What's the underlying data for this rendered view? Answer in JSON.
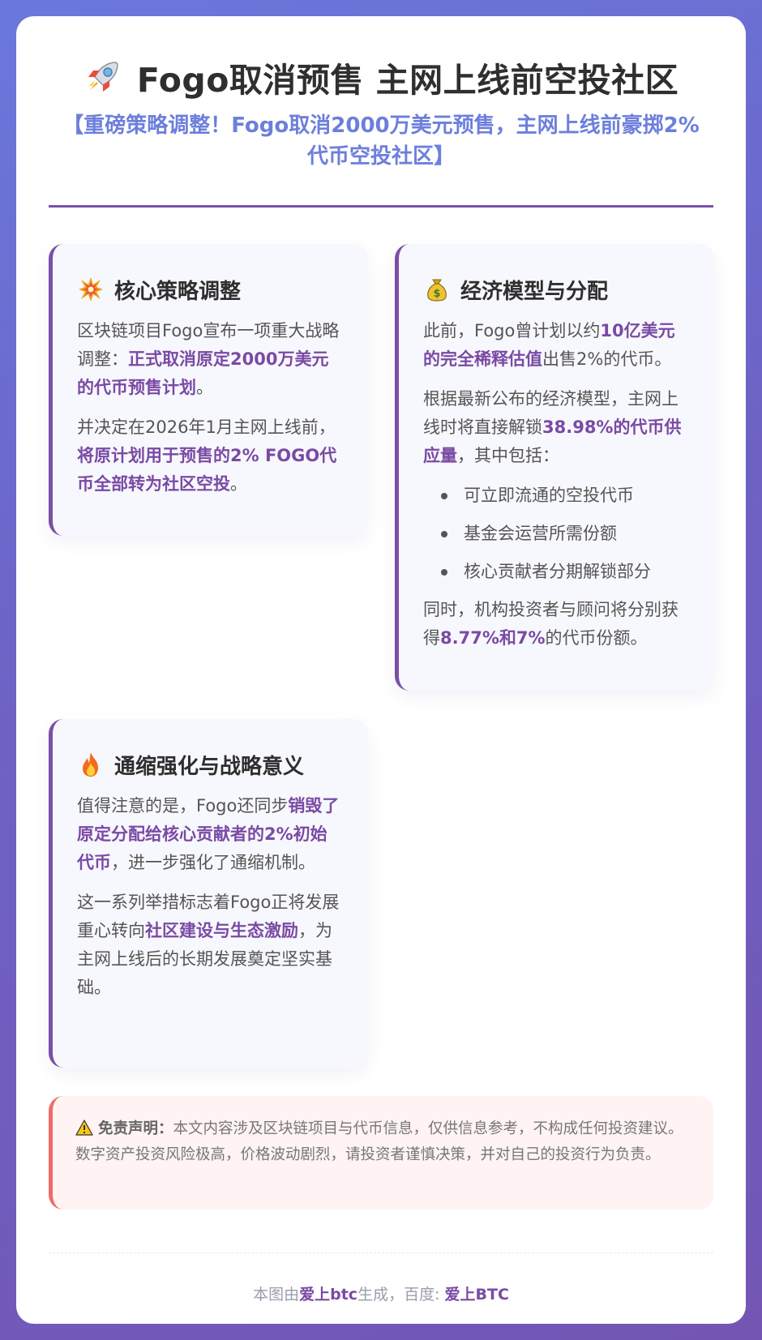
{
  "header": {
    "title": "Fogo取消预售 主网上线前空投社区",
    "subtitle": "【重磅策略调整！Fogo取消2000万美元预售，主网上线前豪掷2%代币空投社区】"
  },
  "card1": {
    "title": "核心策略调整",
    "p1_a": "区块链项目Fogo宣布一项重大战略调整：",
    "p1_hl": "正式取消原定2000万美元的代币预售计划",
    "p1_b": "。",
    "p2_a": "并决定在2026年1月主网上线前，",
    "p2_hl": "将原计划用于预售的2% FOGO代币全部转为社区空投",
    "p2_b": "。"
  },
  "card2": {
    "title": "经济模型与分配",
    "p1_a": "此前，Fogo曾计划以约",
    "p1_hl": "10亿美元的完全稀释估值",
    "p1_b": "出售2%的代币。",
    "p2_a": "根据最新公布的经济模型，主网上线时将直接解锁",
    "p2_hl": "38.98%的代币供应量",
    "p2_b": "，其中包括：",
    "items": [
      "可立即流通的空投代币",
      "基金会运营所需份额",
      "核心贡献者分期解锁部分"
    ],
    "p3_a": "同时，机构投资者与顾问将分别获得",
    "p3_hl": "8.77%和7%",
    "p3_b": "的代币份额。"
  },
  "card3": {
    "title": "通缩强化与战略意义",
    "p1_a": "值得注意的是，Fogo还同步",
    "p1_hl": "销毁了原定分配给核心贡献者的2%初始代币",
    "p1_b": "，进一步强化了通缩机制。",
    "p2_a": "这一系列举措标志着Fogo正将发展重心转向",
    "p2_hl": "社区建设与生态激励",
    "p2_b": "，为主网上线后的长期发展奠定坚实基础。"
  },
  "disclaimer": {
    "label": "免责声明：",
    "text": "本文内容涉及区块链项目与代币信息，仅供信息参考，不构成任何投资建议。数字资产投资风险极高，价格波动剧烈，请投资者谨慎决策，并对自己的投资行为负责。"
  },
  "footer": {
    "prefix": "本图由",
    "brand1": "爱上btc",
    "middle": "生成，百度: ",
    "brand2": "爱上BTC"
  },
  "icons": {
    "title": "rocket-icon",
    "card1": "collision-icon",
    "card2": "money-bag-icon",
    "card3": "fire-icon",
    "disclaimer": "warning-icon"
  },
  "colors": {
    "accent": "#7a4aa4",
    "subtitle": "#6c7fdc",
    "warning_border": "#ee6b6b"
  }
}
